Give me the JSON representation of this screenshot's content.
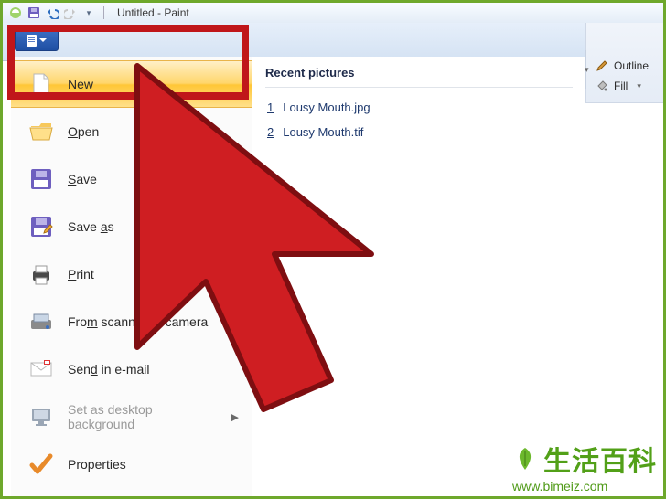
{
  "window": {
    "title": "Untitled - Paint"
  },
  "file_menu": {
    "items": [
      {
        "label": "New",
        "underline_index": 0,
        "hover": true,
        "arrow": false,
        "icon": "blank-page-icon"
      },
      {
        "label": "Open",
        "underline_index": 0,
        "hover": false,
        "arrow": false,
        "icon": "folder-open-icon"
      },
      {
        "label": "Save",
        "underline_index": 0,
        "hover": false,
        "arrow": false,
        "icon": "save-icon"
      },
      {
        "label": "Save as",
        "underline_index": 5,
        "hover": false,
        "arrow": true,
        "icon": "save-as-icon"
      },
      {
        "label": "Print",
        "underline_index": 0,
        "hover": false,
        "arrow": true,
        "icon": "print-icon"
      },
      {
        "label": "From scanner or camera",
        "underline_index": 3,
        "hover": false,
        "arrow": false,
        "icon": "scanner-icon"
      },
      {
        "label": "Send in e-mail",
        "underline_index": 3,
        "hover": false,
        "arrow": false,
        "icon": "mail-icon"
      },
      {
        "label": "Set as desktop background",
        "underline_index": -1,
        "hover": false,
        "arrow": true,
        "icon": "desktop-icon",
        "disabled": true
      },
      {
        "label": "Properties",
        "underline_index": -1,
        "hover": false,
        "arrow": false,
        "icon": "check-icon"
      }
    ]
  },
  "recent": {
    "header": "Recent pictures",
    "items": [
      {
        "num": "1",
        "name": "Lousy Mouth.jpg"
      },
      {
        "num": "2",
        "name": "Lousy Mouth.tif"
      }
    ]
  },
  "ribbon_right": {
    "outline_label": "Outline",
    "fill_label": "Fill"
  },
  "watermark": {
    "zh": "生活百科",
    "url": "www.bimeiz.com"
  },
  "colors": {
    "highlight_red": "#c0161a",
    "hover_gold_top": "#fff0c7",
    "hover_gold_bottom": "#ffc636",
    "green_border": "#6ea82c"
  }
}
